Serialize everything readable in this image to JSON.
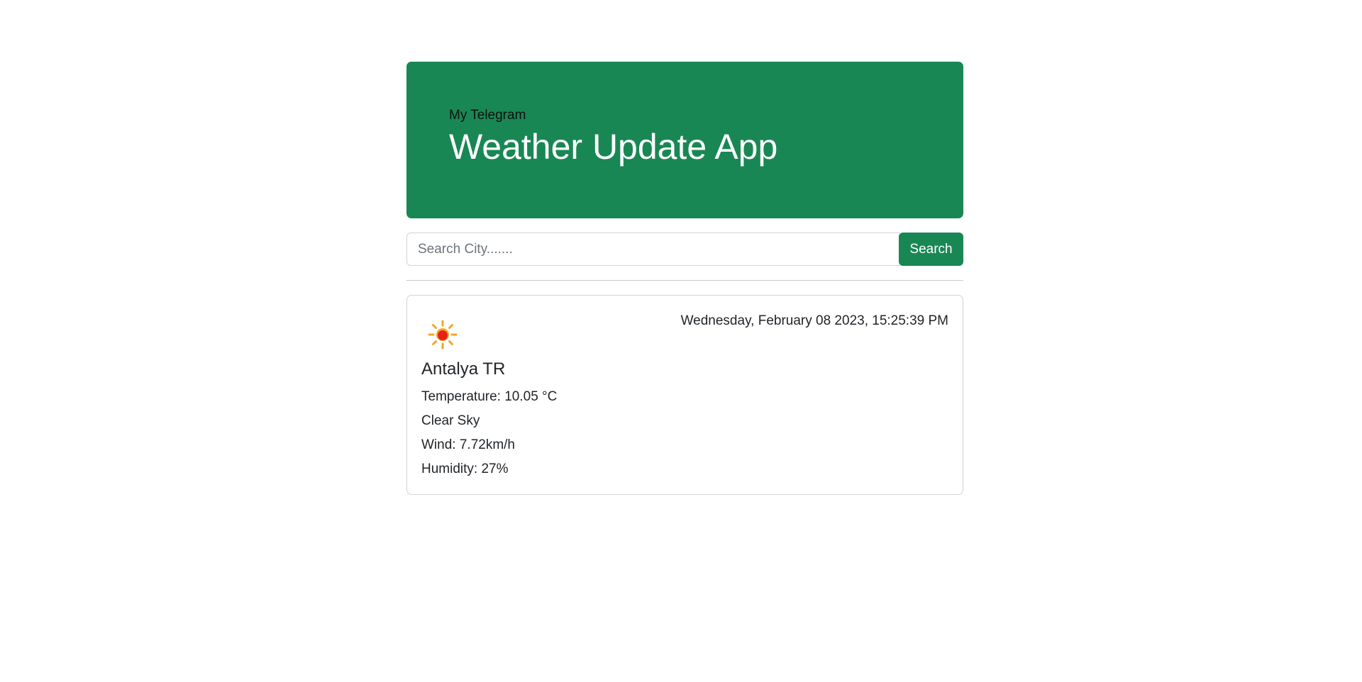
{
  "header": {
    "subtitle": "My Telegram",
    "title": "Weather Update App"
  },
  "search": {
    "placeholder": "Search City.......",
    "value": "",
    "button_label": "Search"
  },
  "weather": {
    "datetime": "Wednesday, February 08 2023, 15:25:39 PM",
    "icon": "clear-sky-sun-icon",
    "city": "Antalya TR",
    "temperature": "Temperature: 10.05 °C",
    "description": "Clear Sky",
    "wind": "Wind: 7.72km/h",
    "humidity": "Humidity: 27%"
  },
  "colors": {
    "accent": "#198754",
    "sun_core": "#e8201a",
    "sun_rays": "#f5a623"
  }
}
